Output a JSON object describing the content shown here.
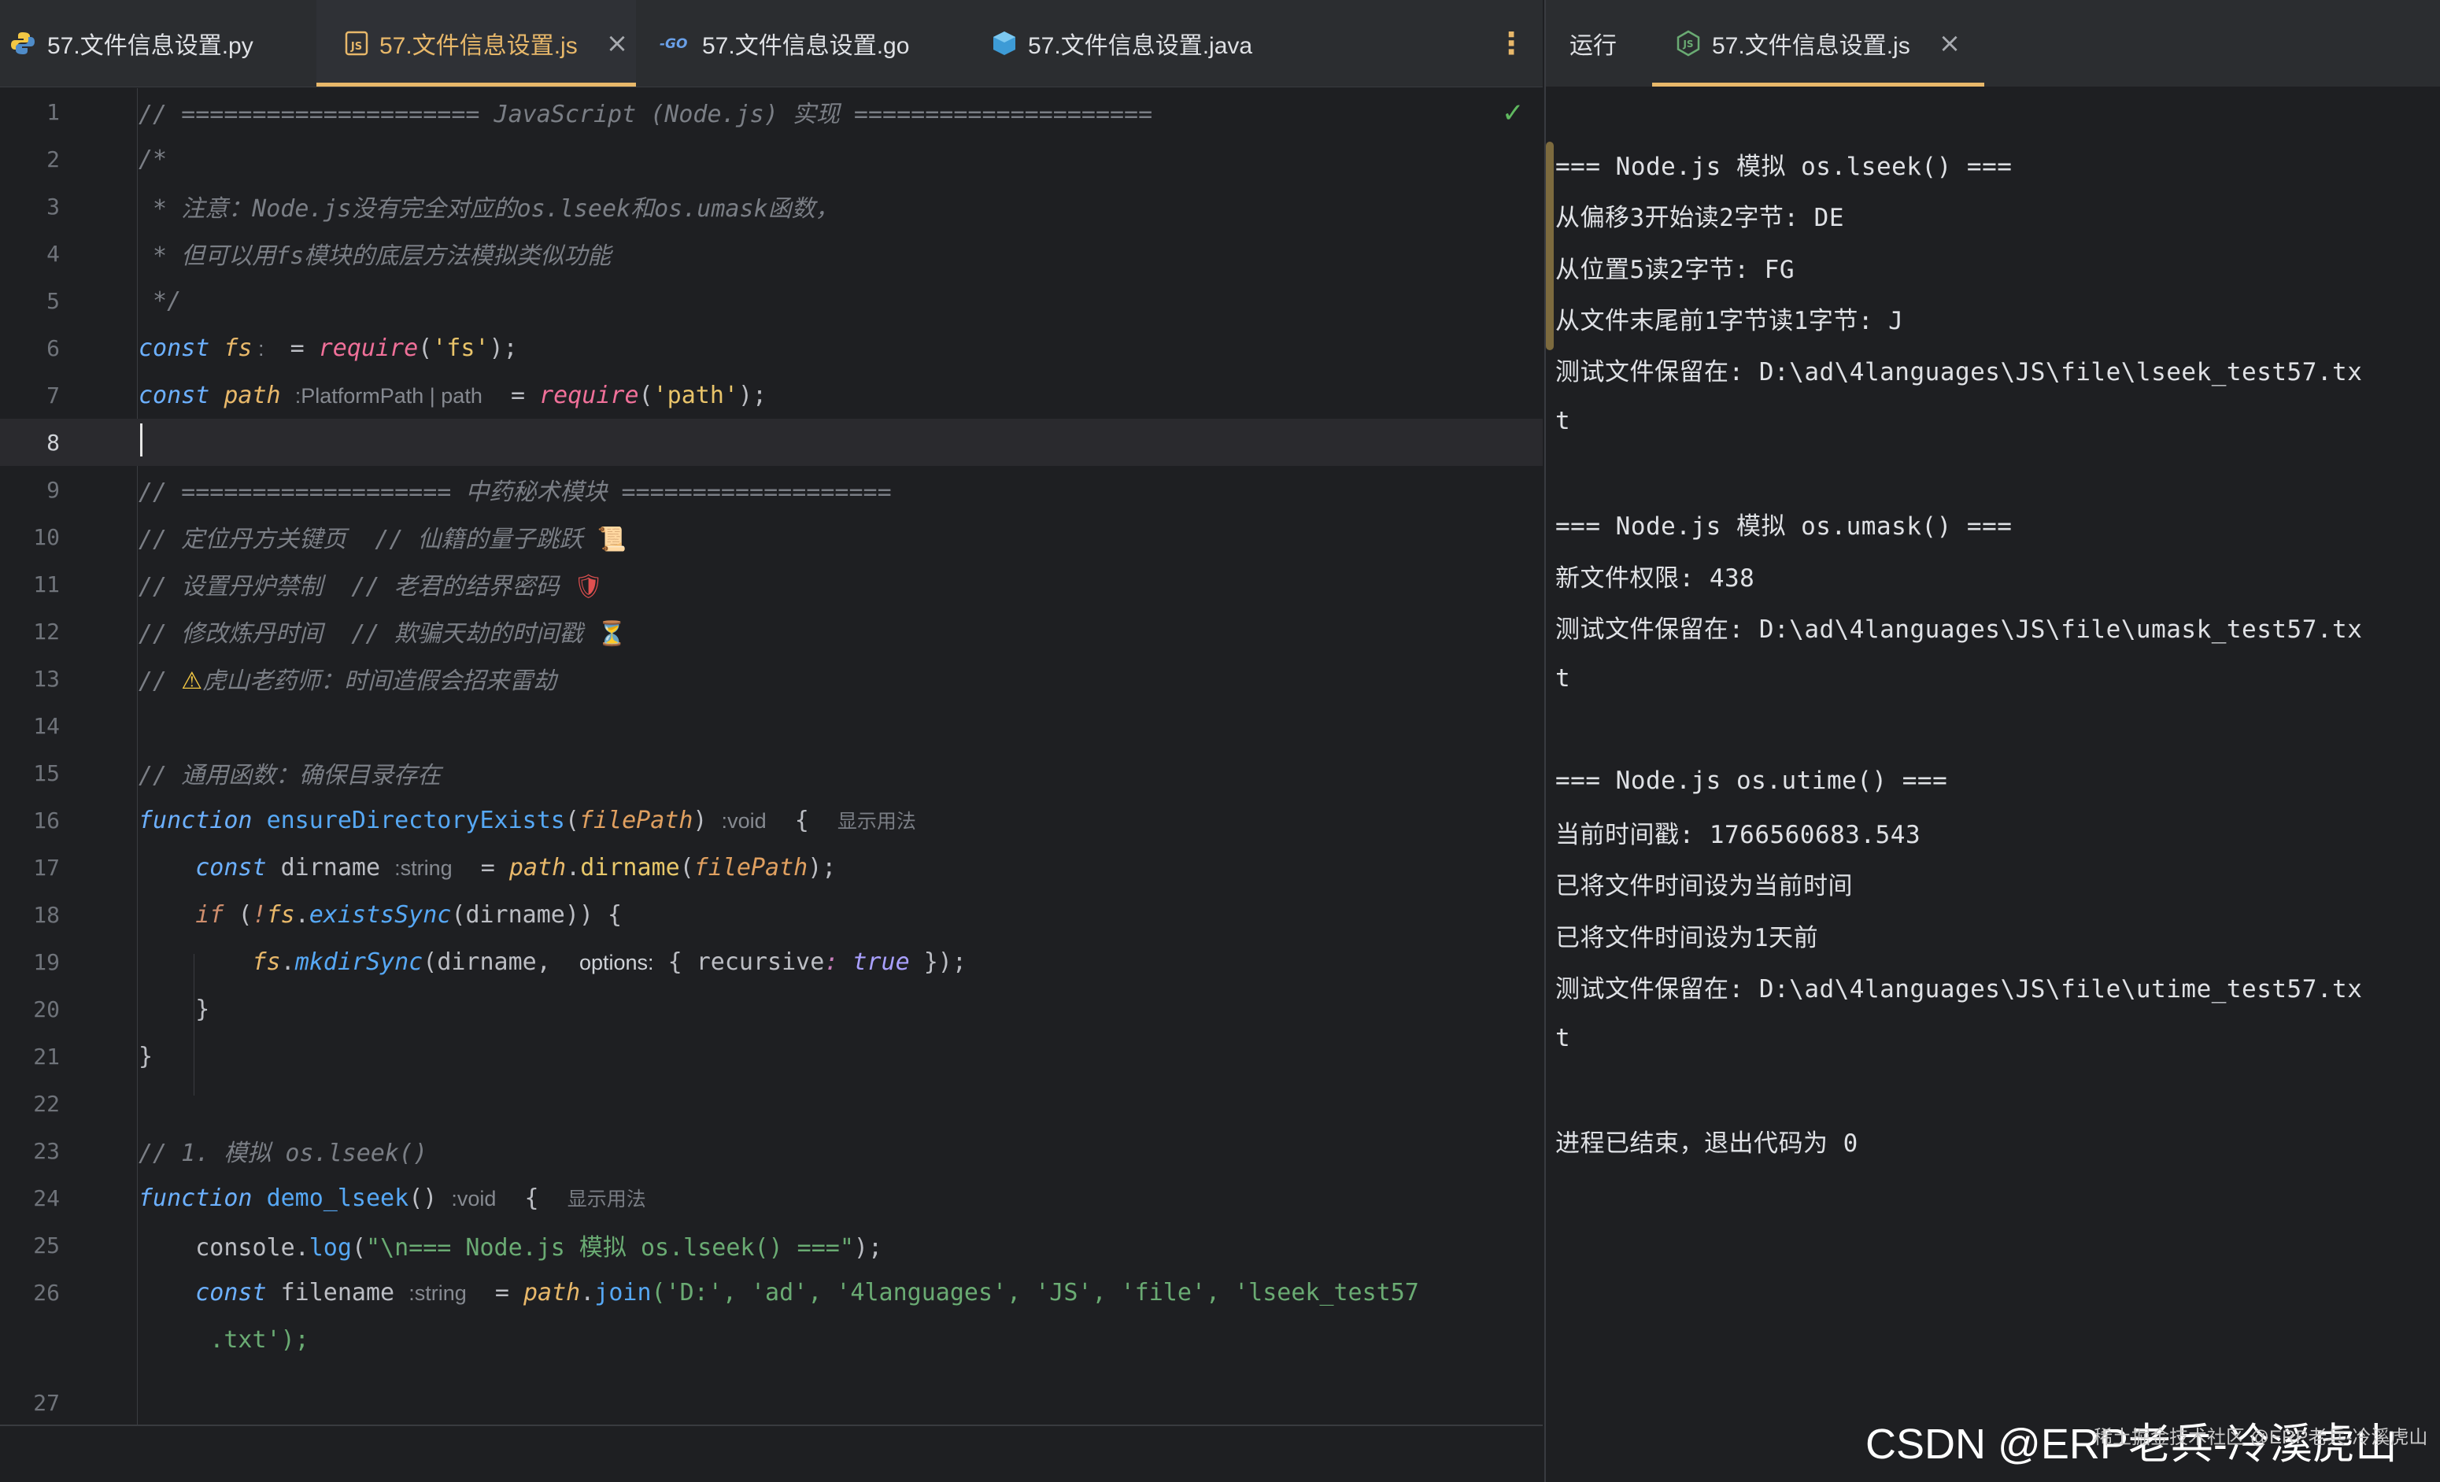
{
  "editor": {
    "tabs": [
      {
        "label": "57.文件信息设置.py",
        "icon": "python-file-icon"
      },
      {
        "label": "57.文件信息设置.js",
        "icon": "javascript-file-icon",
        "active": true
      },
      {
        "label": "57.文件信息设置.go",
        "icon": "go-file-icon"
      },
      {
        "label": "57.文件信息设置.java",
        "icon": "java-file-icon"
      }
    ],
    "close_glyph": "×",
    "more_glyph": "⋮",
    "line_numbers": [
      "1",
      "2",
      "3",
      "4",
      "5",
      "6",
      "7",
      "8",
      "9",
      "10",
      "11",
      "12",
      "13",
      "14",
      "15",
      "16",
      "17",
      "18",
      "19",
      "20",
      "21",
      "22",
      "23",
      "24",
      "25",
      "26",
      "",
      "27"
    ],
    "hints": {
      "path_type": "PlatformPath | path",
      "void": "void",
      "show_usage": "显示用法",
      "string": "string",
      "options": "options:"
    },
    "code": {
      "l1": "// ===================== JavaScript (Node.js) 实现 =====================",
      "l2": "/*",
      "l3": " * 注意：Node.js没有完全对应的os.lseek和os.umask函数，",
      "l4": " * 但可以用fs模块的底层方法模拟类似功能",
      "l5": " */",
      "l9": "// =================== 中药秘术模块 ===================",
      "l10": "// 定位丹方关键页  // 仙籍的量子跳跃 ",
      "l11": "// 设置丹炉禁制  // 老君的结界密码 ",
      "l12": "// 修改炼丹时间  // 欺骗天劫的时间戳 ",
      "l13a": "// ",
      "l13b": "虎山老药师：时间造假会招来雷劫",
      "l15": "// 通用函数：确保目录存在",
      "l23": "// 1. 模拟 os.lseek()",
      "fs": "fs",
      "path": "path",
      "require": "require",
      "fs_str": "'fs'",
      "path_str": "'path'",
      "ensure_fn": "ensureDirectoryExists",
      "filePath": "filePath",
      "dirname_var": "dirname",
      "dirname_fn": "dirname",
      "existsSync": "existsSync",
      "mkdirSync": "mkdirSync",
      "recursive": "recursive",
      "true_kw": "true",
      "demo_fn": "demo_lseek",
      "console_log": "console",
      "log": "log",
      "log_str": "\"\\n=== Node.js 模拟 os.lseek() ===\"",
      "filename_var": "filename",
      "join": "join",
      "join_args": "('D:', 'ad', '4languages', 'JS', 'file', 'lseek_test57",
      "join_args2": ".txt');"
    },
    "emoji": {
      "scroll": "📜",
      "shield": "🛡",
      "hourglass": "⏳",
      "warning": "⚠"
    },
    "check_glyph": "✓"
  },
  "run": {
    "label": "运行",
    "tab_label": "57.文件信息设置.js",
    "output": [
      "=== Node.js 模拟 os.lseek() ===",
      "从偏移3开始读2字节: DE",
      "从位置5读2字节: FG",
      "从文件末尾前1字节读1字节: J",
      "测试文件保留在: D:\\ad\\4languages\\JS\\file\\lseek_test57.tx",
      "t",
      "",
      "=== Node.js 模拟 os.umask() ===",
      "新文件权限: 438",
      "测试文件保留在: D:\\ad\\4languages\\JS\\file\\umask_test57.tx",
      "t",
      "",
      "=== Node.js os.utime() ===",
      "当前时间戳: 1766560683.543",
      "已将文件时间设为当前时间",
      "已将文件时间设为1天前",
      "测试文件保留在: D:\\ad\\4languages\\JS\\file\\utime_test57.tx",
      "t",
      "",
      "进程已结束，退出代码为 0"
    ]
  },
  "watermark": {
    "main": "CSDN @ERP老兵-冷溪虎山",
    "small": "稀土掘金技术社区 @ERP老兵-冷溪虎山"
  }
}
